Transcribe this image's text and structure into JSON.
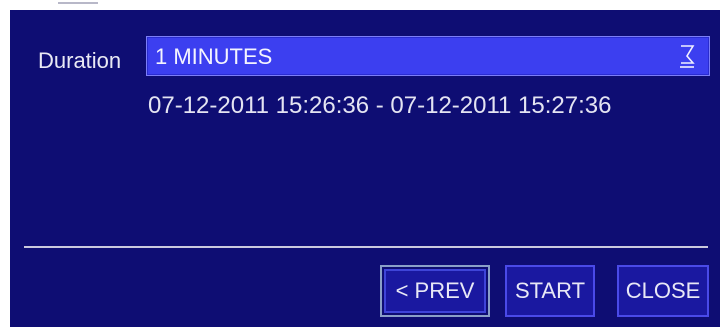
{
  "dialog": {
    "duration_label": "Duration",
    "duration_value": "1 MINUTES",
    "time_range": "07-12-2011 15:26:36 - 07-12-2011 15:27:36"
  },
  "buttons": {
    "prev": "< PREV",
    "start": "START",
    "close": "CLOSE"
  },
  "icons": {
    "dropdown": "dropdown-icon"
  },
  "colors": {
    "background": "#0e0d73",
    "select_fill": "#3c3ff0",
    "text": "#e9e9f4"
  }
}
